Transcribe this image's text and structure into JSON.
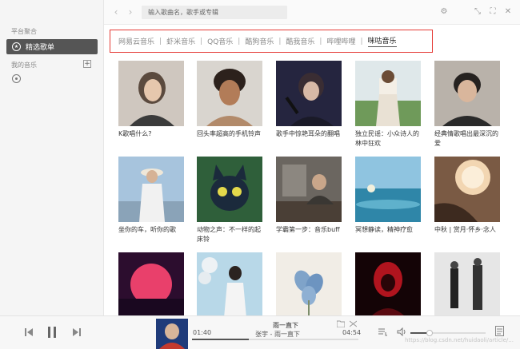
{
  "sidebar": {
    "section_platform": "平台聚合",
    "active_item": "精选歌单",
    "section_my_music": "我的音乐",
    "add_symbol": "+"
  },
  "topbar": {
    "back_arrow": "‹",
    "forward_arrow": "›",
    "search_placeholder": "输入歌曲名，歌手或专辑",
    "settings_icon": "⚙",
    "shrink_icon": "⤡",
    "fullscreen_icon": "⛶",
    "close_icon": "✕"
  },
  "tabs": {
    "items": [
      "网易云音乐",
      "虾米音乐",
      "QQ音乐",
      "酷狗音乐",
      "酷我音乐",
      "哔哩哔哩",
      "咪咕音乐"
    ],
    "active_index": 6,
    "highlight_color": "#e53935"
  },
  "playlists": [
    {
      "title": "K歌唱什么?"
    },
    {
      "title": "回头率超高的手机铃声"
    },
    {
      "title": "歌手中惊艳耳朵的翻唱"
    },
    {
      "title": "独立民谣：小众诗人的林中狂欢"
    },
    {
      "title": "经典情歌唱出最深沉的爱"
    },
    {
      "title": "坐你的车，听你的歌"
    },
    {
      "title": "动物之声：不一样的起床铃"
    },
    {
      "title": "学霸第一步：音乐buff"
    },
    {
      "title": "冥想静读，精神疗愈"
    },
    {
      "title": "中秋 | 赏月·怀乡·念人"
    },
    {
      "title": ""
    },
    {
      "title": ""
    },
    {
      "title": ""
    },
    {
      "title": ""
    },
    {
      "title": ""
    }
  ],
  "player": {
    "song_title": "雨一直下",
    "song_artist": "张宇 - 雨一直下",
    "current_time": "01:40",
    "total_time": "04:54",
    "progress": 0.34,
    "volume": 0.26
  },
  "watermark": "https://blog.csdn.net/huidaoli/article/..."
}
